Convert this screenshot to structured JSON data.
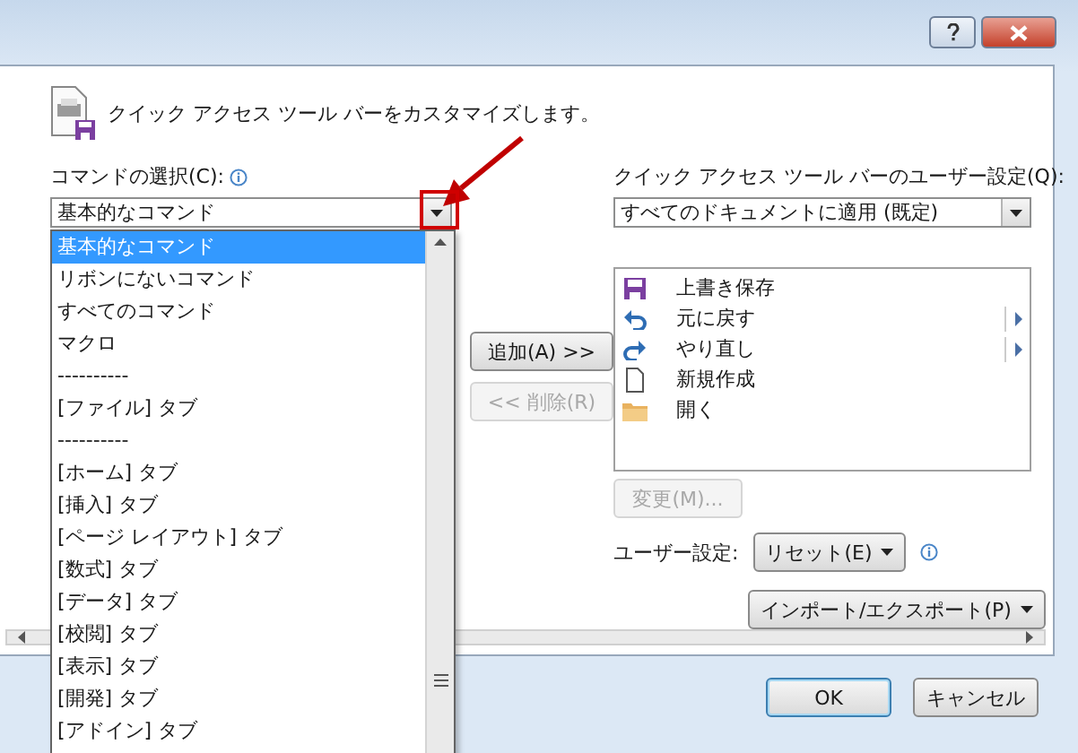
{
  "header": {
    "title": "クイック アクセス ツール バーをカスタマイズします。"
  },
  "commands": {
    "label": "コマンドの選択(C):",
    "value": "基本的なコマンド",
    "expanded": true,
    "options": [
      {
        "label": "基本的なコマンド",
        "selected": true
      },
      {
        "label": "リボンにないコマンド",
        "selected": false
      },
      {
        "label": "すべてのコマンド",
        "selected": false
      },
      {
        "label": "マクロ",
        "selected": false
      },
      {
        "label": "----------",
        "selected": false
      },
      {
        "label": "[ファイル] タブ",
        "selected": false
      },
      {
        "label": "----------",
        "selected": false
      },
      {
        "label": "[ホーム] タブ",
        "selected": false
      },
      {
        "label": "[挿入] タブ",
        "selected": false
      },
      {
        "label": "[ページ レイアウト] タブ",
        "selected": false
      },
      {
        "label": "[数式] タブ",
        "selected": false
      },
      {
        "label": "[データ] タブ",
        "selected": false
      },
      {
        "label": "[校閲] タブ",
        "selected": false
      },
      {
        "label": "[表示] タブ",
        "selected": false
      },
      {
        "label": "[開発] タブ",
        "selected": false
      },
      {
        "label": "[アドイン] タブ",
        "selected": false
      }
    ]
  },
  "actions": [
    {
      "label": "追加(A) >>",
      "disabled": false
    },
    {
      "label": "<< 削除(R)",
      "disabled": true
    }
  ],
  "customize": {
    "label": "クイック アクセス ツール バーのユーザー設定(Q):",
    "value": "すべてのドキュメントに適用 (既定)",
    "items": [
      {
        "kind": "save",
        "label": "上書き保存",
        "has_submenu": false
      },
      {
        "kind": "undo",
        "label": "元に戻す",
        "has_submenu": true
      },
      {
        "kind": "redo",
        "label": "やり直し",
        "has_submenu": true
      },
      {
        "kind": "new",
        "label": "新規作成",
        "has_submenu": false
      },
      {
        "kind": "open",
        "label": "開く",
        "has_submenu": false
      }
    ],
    "modify": {
      "label": "変更(M)...",
      "disabled": true
    }
  },
  "user_settings": {
    "label": "ユーザー設定:",
    "reset": "リセット(E)",
    "import_export": "インポート/エクスポート(P)"
  },
  "footer": {
    "ok": "OK",
    "cancel": "キャンセル"
  }
}
